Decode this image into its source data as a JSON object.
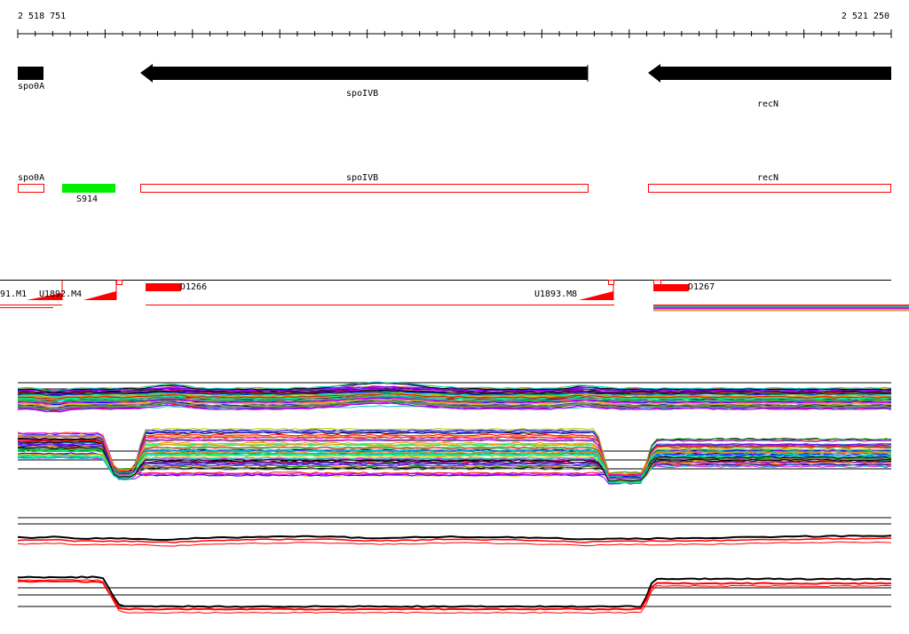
{
  "ruler": {
    "start_label": "2 518 751",
    "end_label": "2 521 250"
  },
  "genes": [
    {
      "name": "spo0A",
      "strand": "-"
    },
    {
      "name": "spoIVB",
      "strand": "-"
    },
    {
      "name": "recN",
      "strand": "-"
    }
  ],
  "annotations": {
    "genes": [
      "spo0A",
      "spoIVB",
      "recN"
    ],
    "features": [
      {
        "name": "S914",
        "color": "#00ee00"
      }
    ]
  },
  "segments": [
    {
      "name": "91.M1"
    },
    {
      "name": "U1892.M4"
    },
    {
      "name": "D1266"
    },
    {
      "name": "U1893.M8"
    },
    {
      "name": "D1267"
    }
  ],
  "colors": {
    "gene_arrow": "#000000",
    "gene_box": "#ff0000",
    "segment": "#ff0000",
    "green_feature": "#00ee00",
    "profile_palette": [
      "#ff0000",
      "#00aa00",
      "#0000ff",
      "#ff00ff",
      "#00cccc",
      "#cccc00",
      "#ff8800",
      "#8800ff",
      "#00ff88",
      "#888888",
      "#000000"
    ]
  }
}
